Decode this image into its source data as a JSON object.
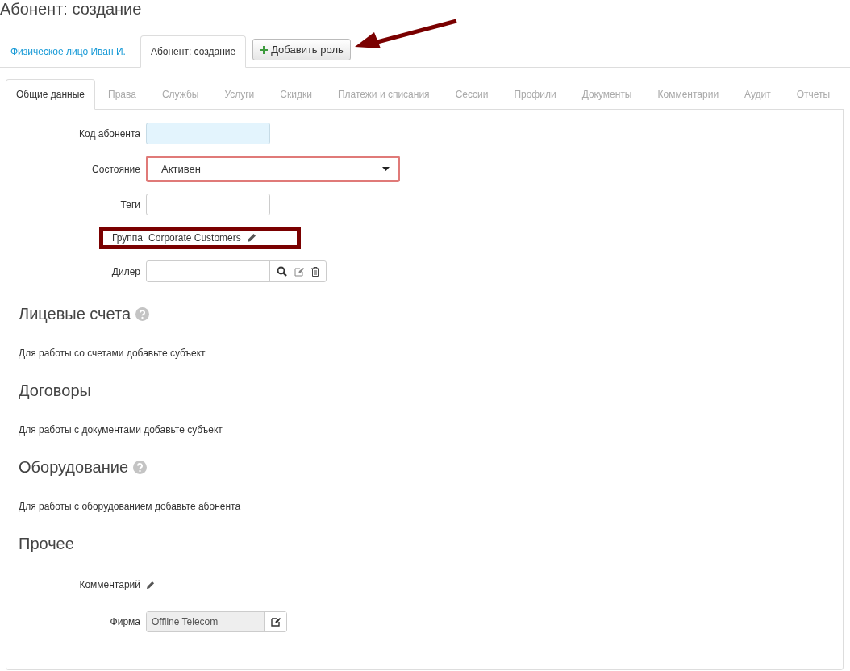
{
  "title": "Абонент: создание",
  "top_tabs": [
    {
      "label": "Физическое лицо Иван И.",
      "selected": false
    },
    {
      "label": "Абонент: создание",
      "selected": true
    }
  ],
  "add_role_button": {
    "label": "Добавить роль"
  },
  "tabs": [
    {
      "label": "Общие данные",
      "selected": true
    },
    {
      "label": "Права",
      "selected": false
    },
    {
      "label": "Службы",
      "selected": false
    },
    {
      "label": "Услуги",
      "selected": false
    },
    {
      "label": "Скидки",
      "selected": false
    },
    {
      "label": "Платежи и списания",
      "selected": false
    },
    {
      "label": "Сессии",
      "selected": false
    },
    {
      "label": "Профили",
      "selected": false
    },
    {
      "label": "Документы",
      "selected": false
    },
    {
      "label": "Комментарии",
      "selected": false
    },
    {
      "label": "Аудит",
      "selected": false
    },
    {
      "label": "Отчеты",
      "selected": false
    }
  ],
  "fields": [
    {
      "kind": "input",
      "label": "Код абонента",
      "tinted": true
    },
    {
      "kind": "select",
      "label": "Состояние",
      "value": "Активен",
      "invalid": true
    },
    {
      "kind": "input",
      "label": "Теги",
      "tinted": false
    },
    {
      "kind": "text",
      "label": "Группа",
      "value": "Corporate Customers",
      "boxed": true
    },
    {
      "kind": "lookup",
      "label": "Дилер"
    }
  ],
  "sections": [
    {
      "title": "Лицевые счета",
      "help": true,
      "message": "Для работы со счетами добавьте субъект"
    },
    {
      "title": "Договоры",
      "help": false,
      "message": "Для работы с документами добавьте субъект"
    },
    {
      "title": "Оборудование",
      "help": true,
      "message": "Для работы с оборудованием добавьте абонента"
    }
  ],
  "other": {
    "title": "Прочее",
    "fields": [
      {
        "kind": "edit",
        "label": "Комментарий"
      },
      {
        "kind": "readonly",
        "label": "Фирма",
        "value": "Offline Telecom"
      }
    ]
  }
}
